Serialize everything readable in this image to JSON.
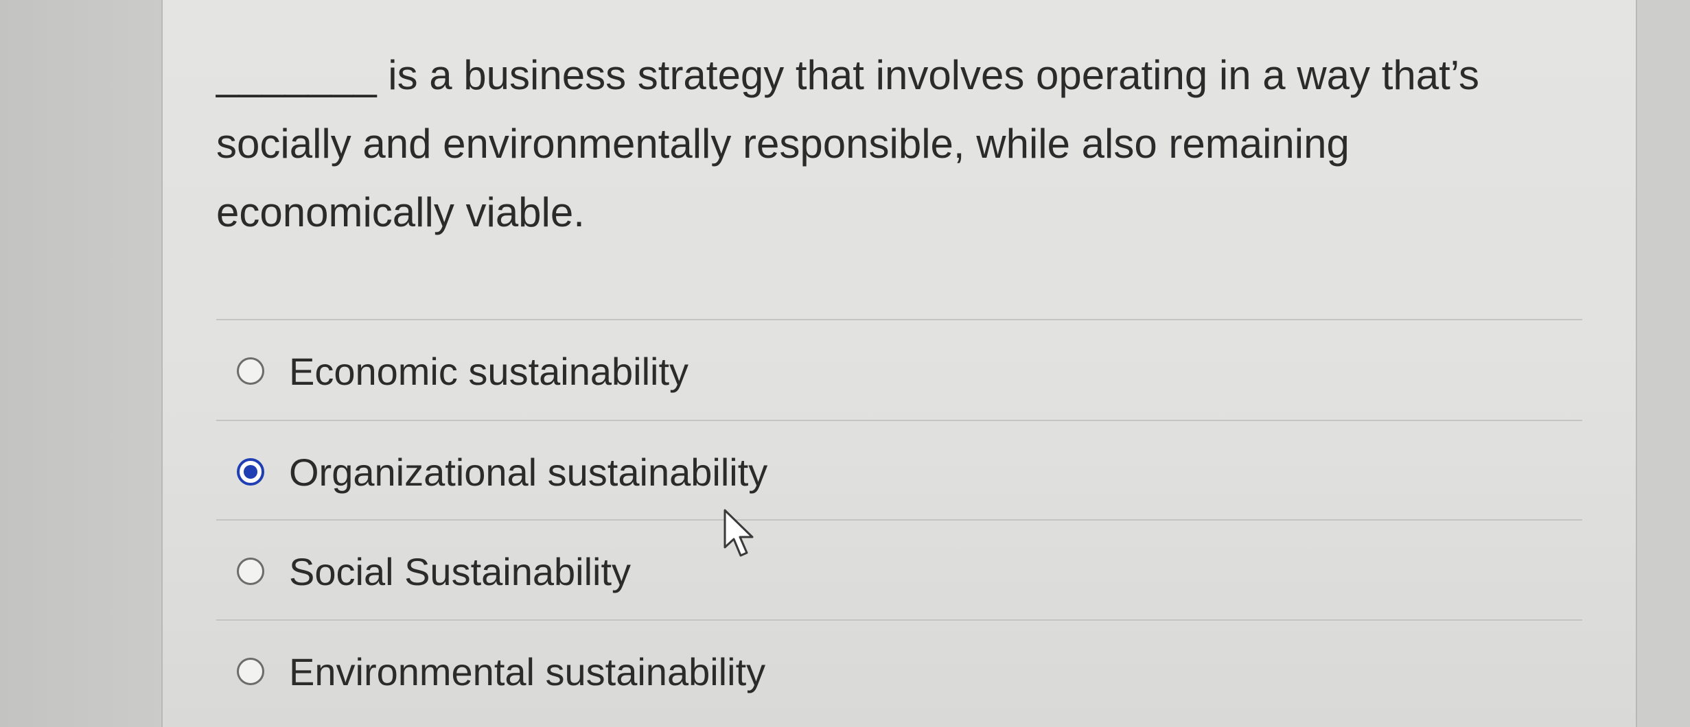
{
  "question": {
    "text": "_______ is a business strategy that involves operating in a way that’s socially and environmentally responsible, while also remaining economically viable."
  },
  "options": [
    {
      "label": "Economic sustainability",
      "selected": false
    },
    {
      "label": "Organizational sustainability",
      "selected": true
    },
    {
      "label": "Social Sustainability",
      "selected": false
    },
    {
      "label": "Environmental sustainability",
      "selected": false
    }
  ],
  "colors": {
    "selected_radio": "#1f3fb3",
    "text": "#2b2b2b",
    "card_background": "#e2e2e0"
  },
  "icons": {
    "cursor": "mouse-pointer-icon"
  }
}
